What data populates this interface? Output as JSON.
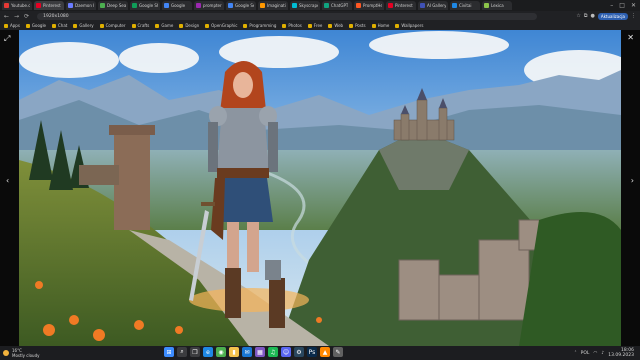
{
  "browser": {
    "tabs": [
      {
        "label": "Youtube.com",
        "color": "#e53935"
      },
      {
        "label": "Pinterest",
        "color": "#e60023",
        "active": true
      },
      {
        "label": "Daemon Hunt",
        "color": "#6b7cff"
      },
      {
        "label": "Deep Search",
        "color": "#4caf50"
      },
      {
        "label": "Google Sheets",
        "color": "#0f9d58"
      },
      {
        "label": "Google",
        "color": "#4285f4"
      },
      {
        "label": "prompter",
        "color": "#9c27b0"
      },
      {
        "label": "Google Search",
        "color": "#4285f4"
      },
      {
        "label": "Imagination",
        "color": "#ff9800"
      },
      {
        "label": "Skyscraper",
        "color": "#00bcd4"
      },
      {
        "label": "ChatGPT",
        "color": "#10a37f"
      },
      {
        "label": "PromptHero",
        "color": "#ff5722"
      },
      {
        "label": "Pinterest",
        "color": "#e60023"
      },
      {
        "label": "AI Gallery",
        "color": "#3f51b5"
      },
      {
        "label": "Civitai",
        "color": "#1e88e5"
      },
      {
        "label": "Lexica",
        "color": "#8bc34a"
      }
    ],
    "window_controls": [
      "–",
      "□",
      "✕"
    ],
    "address": "1920x1080",
    "nav": [
      "←",
      "→",
      "⟳"
    ],
    "toolbar_right_cta": "Aktualizacja",
    "bookmarks": [
      "Apps",
      "Google",
      "Chat",
      "Gallery",
      "Computer",
      "Crafts",
      "Game",
      "Design",
      "OpenGraphic",
      "Programming",
      "Photos",
      "Free",
      "Web",
      "Posts",
      "Home",
      "Wallpapers"
    ]
  },
  "viewer": {
    "left_control_icon": "expand-icon",
    "close_icon": "close-icon",
    "prev_icon": "chevron-left-icon",
    "next_icon": "chevron-right-icon"
  },
  "taskbar": {
    "weather_temp": "16°C",
    "weather_text": "Mostly cloudy",
    "apps": [
      {
        "icon": "start-icon",
        "color": "#3c8cff",
        "glyph": "⊞"
      },
      {
        "icon": "search-icon",
        "color": "#3b3c3f",
        "glyph": "⌕"
      },
      {
        "icon": "task-view-icon",
        "color": "#3b3c3f",
        "glyph": "❐"
      },
      {
        "icon": "edge-icon",
        "color": "#1e88e5",
        "glyph": "e"
      },
      {
        "icon": "chrome-icon",
        "color": "#4caf50",
        "glyph": "◉"
      },
      {
        "icon": "folder-icon",
        "color": "#f2c14e",
        "glyph": "▮"
      },
      {
        "icon": "mail-icon",
        "color": "#1976d2",
        "glyph": "✉"
      },
      {
        "icon": "store-icon",
        "color": "#7e57c2",
        "glyph": "▦"
      },
      {
        "icon": "spotify-icon",
        "color": "#1db954",
        "glyph": "♫"
      },
      {
        "icon": "discord-icon",
        "color": "#5865f2",
        "glyph": "☺"
      },
      {
        "icon": "steam-icon",
        "color": "#2a475e",
        "glyph": "⚙"
      },
      {
        "icon": "photoshop-icon",
        "color": "#0a2a4a",
        "glyph": "Ps"
      },
      {
        "icon": "vlc-icon",
        "color": "#ff8800",
        "glyph": "▲"
      },
      {
        "icon": "notes-icon",
        "color": "#616161",
        "glyph": "✎"
      }
    ],
    "tray_lang": "POL",
    "time": "18:06",
    "date": "13.09.2023"
  }
}
